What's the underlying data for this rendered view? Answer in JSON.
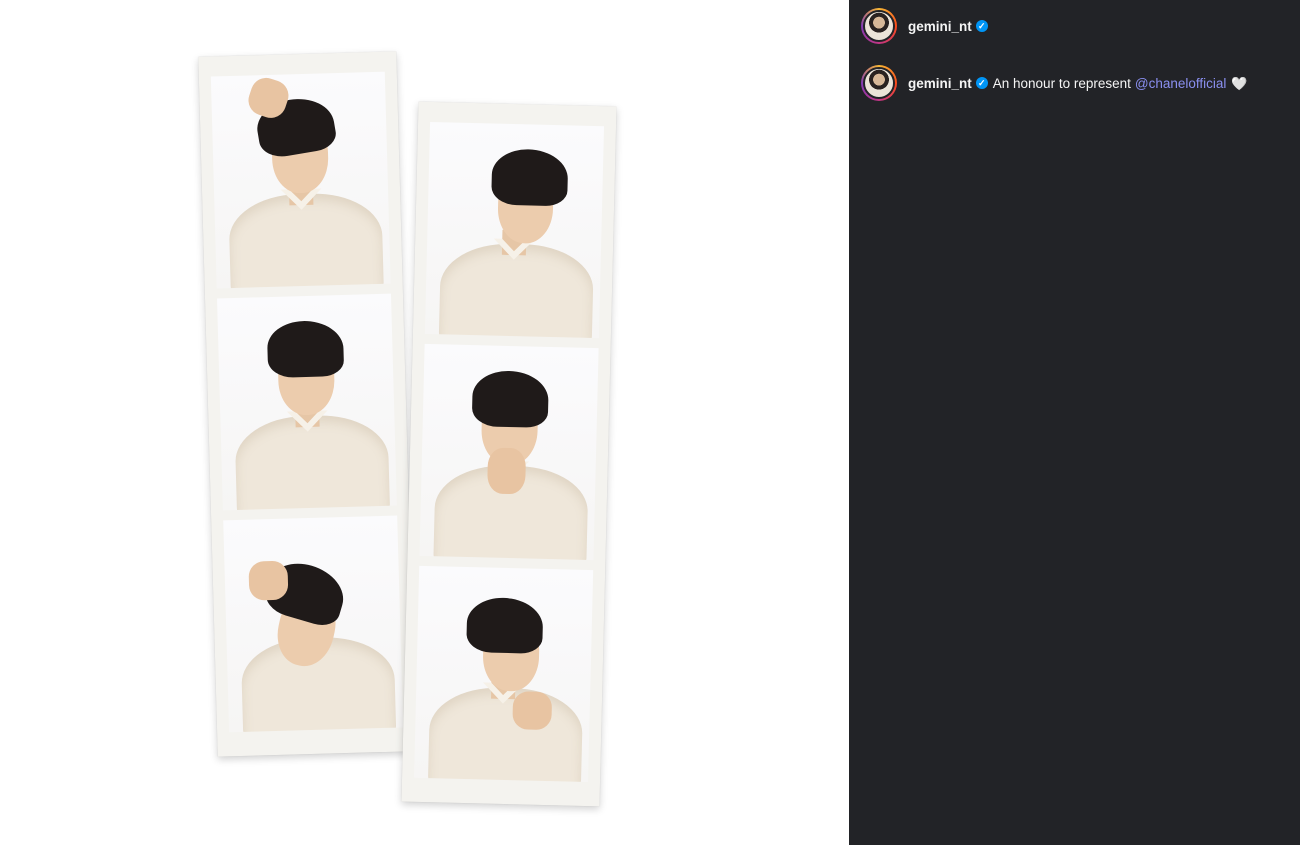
{
  "post": {
    "author": {
      "username": "gemini_nt",
      "verified": true,
      "avatar_icon": "profile-avatar"
    },
    "caption": {
      "username": "gemini_nt",
      "verified": true,
      "text": "An honour to represent",
      "mention": "@chanelofficial",
      "emoji": "🤍"
    }
  },
  "theme": {
    "sidebar_bg": "#222327",
    "text_color": "#f5f5f5",
    "mention_color": "#8a8ff0",
    "verified_color": "#0095f6"
  },
  "icons": {
    "verified": "verified-badge-icon",
    "heart": "white-heart-icon"
  }
}
